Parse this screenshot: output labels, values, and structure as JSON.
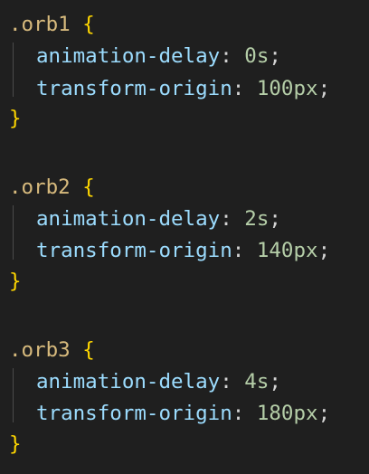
{
  "colors": {
    "background": "#1f1f1f",
    "selector": "#d7ba7d",
    "brace": "#ffd700",
    "property": "#9cdcfe",
    "punctuation": "#d4d4d4",
    "number": "#b5cea8",
    "indent_guide": "#4a4a4a"
  },
  "syntax": {
    "open_brace": "{",
    "close_brace": "}",
    "colon": ":",
    "semicolon": ";"
  },
  "rules": [
    {
      "selector": ".orb1",
      "declarations": [
        {
          "property": "animation-delay",
          "value": "0s"
        },
        {
          "property": "transform-origin",
          "value": "100px"
        }
      ]
    },
    {
      "selector": ".orb2",
      "declarations": [
        {
          "property": "animation-delay",
          "value": "2s"
        },
        {
          "property": "transform-origin",
          "value": "140px"
        }
      ]
    },
    {
      "selector": ".orb3",
      "declarations": [
        {
          "property": "animation-delay",
          "value": "4s"
        },
        {
          "property": "transform-origin",
          "value": "180px"
        }
      ]
    }
  ]
}
